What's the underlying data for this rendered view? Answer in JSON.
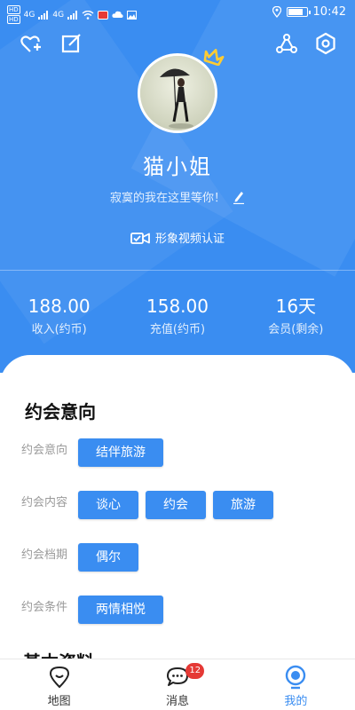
{
  "status_bar": {
    "left_badges": [
      "HD",
      "HD"
    ],
    "signal_labels": [
      "4G",
      "4G"
    ],
    "time": "10:42"
  },
  "profile": {
    "username": "猫小姐",
    "signature": "寂寞的我在这里等你！",
    "verify_label": "形象视频认证"
  },
  "stats": [
    {
      "value": "188.00",
      "label": "收入(约币)"
    },
    {
      "value": "158.00",
      "label": "充值(约币)"
    },
    {
      "value": "16天",
      "label": "会员(剩余)"
    }
  ],
  "dating": {
    "title": "约会意向",
    "rows": [
      {
        "label": "约会意向",
        "chips": [
          "结伴旅游"
        ]
      },
      {
        "label": "约会内容",
        "chips": [
          "谈心",
          "约会",
          "旅游"
        ]
      },
      {
        "label": "约会档期",
        "chips": [
          "偶尔"
        ]
      },
      {
        "label": "约会条件",
        "chips": [
          "两情相悦"
        ]
      }
    ]
  },
  "next_section_title": "基本资料",
  "tabs": [
    {
      "label": "地图",
      "icon": "map-pin-icon"
    },
    {
      "label": "消息",
      "icon": "chat-bubble-icon",
      "badge": "12"
    },
    {
      "label": "我的",
      "icon": "profile-icon",
      "active": true
    }
  ],
  "colors": {
    "primary": "#3a8df1",
    "badge": "#e53935"
  }
}
